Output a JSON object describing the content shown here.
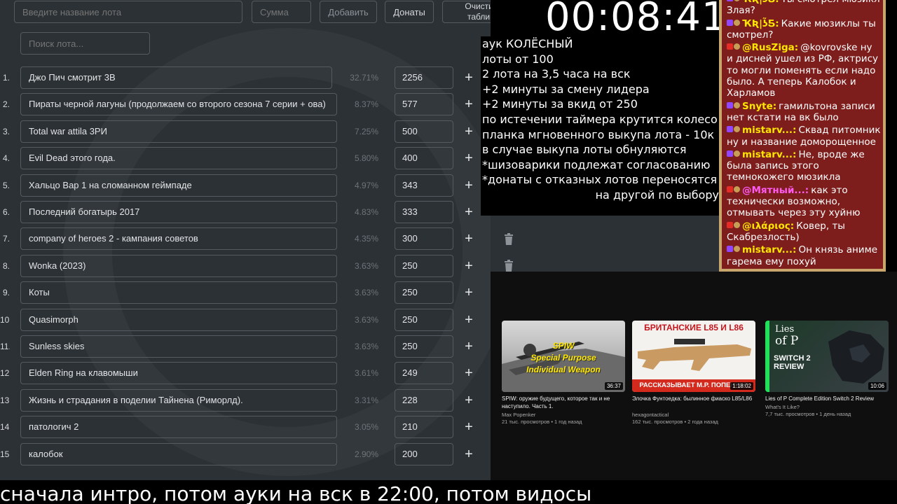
{
  "auction": {
    "lot_name_placeholder": "Введите название лота",
    "amount_placeholder": "Сумма",
    "add_button": "Добавить",
    "donations_button": "Донаты",
    "clear_line1": "Очистить",
    "clear_line2": "таблицу",
    "search_placeholder": "Поиск лота...",
    "lots": [
      {
        "num": "1.",
        "name": "Джо Пич смотрит 3В",
        "percent": "32.71%",
        "amount": "2256"
      },
      {
        "num": "2.",
        "name": "Пираты черной лагуны (продолжаем со второго сезона 7 серии + ова)",
        "percent": "8.37%",
        "amount": "577"
      },
      {
        "num": "3.",
        "name": "Total war attila 3РИ",
        "percent": "7.25%",
        "amount": "500"
      },
      {
        "num": "4.",
        "name": "Evil Dead этого года.",
        "percent": "5.80%",
        "amount": "400"
      },
      {
        "num": "5.",
        "name": "Хальцо Вар 1 на сломанном геймпаде",
        "percent": "4.97%",
        "amount": "343"
      },
      {
        "num": "6.",
        "name": "Последний богатырь 2017",
        "percent": "4.83%",
        "amount": "333"
      },
      {
        "num": "7.",
        "name": "company of heroes 2 - кампания советов",
        "percent": "4.35%",
        "amount": "300"
      },
      {
        "num": "8.",
        "name": "Wonka (2023)",
        "percent": "3.63%",
        "amount": "250"
      },
      {
        "num": "9.",
        "name": "Коты",
        "percent": "3.63%",
        "amount": "250"
      },
      {
        "num": "10.",
        "name": "Quasimorph",
        "percent": "3.63%",
        "amount": "250"
      },
      {
        "num": "11.",
        "name": "Sunless skies",
        "percent": "3.63%",
        "amount": "250"
      },
      {
        "num": "12.",
        "name": "Elden Ring на клавомыши",
        "percent": "3.61%",
        "amount": "249"
      },
      {
        "num": "13.",
        "name": "Жизнь и страдания в поделии Тайнена (Риморлд).",
        "percent": "3.31%",
        "amount": "228"
      },
      {
        "num": "14.",
        "name": "патологич 2",
        "percent": "3.05%",
        "amount": "210"
      },
      {
        "num": "15.",
        "name": "калобок",
        "percent": "2.90%",
        "amount": "200"
      }
    ],
    "plus_symbol": "+"
  },
  "timer": "00:08:41",
  "rules": [
    "аук КОЛЁСНЫЙ",
    "лоты от 100",
    "2 лота на 3,5 часа на вск",
    "+2 минуты за смену лидера",
    "+2 минуты за вкид от 250",
    "по истечении таймера крутится колесо",
    "планка мгновенного выкупа лота - 10к",
    "в случае выкупа лоты обнуляются",
    "*шизоварики подлежат согласованию",
    "*донаты с отказных лотов переносятся",
    "на другой по выбору"
  ],
  "chat": [
    {
      "platform": "twitch",
      "nick": "ҠƦ|ʖ̃Ƽ:",
      "nick_color": "#ffe600",
      "text": "Ты смотрел мюзикл Злая?"
    },
    {
      "platform": "twitch",
      "nick": "ҠƦ|ʖ̃Ƽ:",
      "nick_color": "#ffe600",
      "text": "Какие мюзиклы ты смотрел?"
    },
    {
      "platform": "youtube",
      "nick": "@RusZiga:",
      "nick_color": "#ffe600",
      "text": "@kovrovske ну и дисней ушел из РФ, актрису то могли поменять если надо было. А теперь Калобок и Харламов"
    },
    {
      "platform": "twitch",
      "nick": "Snyte:",
      "nick_color": "#ffe600",
      "text": "гамильтона записи нет кстати на вк было"
    },
    {
      "platform": "twitch",
      "nick": "mistarv...:",
      "nick_color": "#ffe600",
      "text": "Сквад питомник ну и название доморощенное"
    },
    {
      "platform": "twitch",
      "nick": "mistarv...:",
      "nick_color": "#ffe600",
      "text": "Не, вроде же была запись этого темнокожего мюзикла"
    },
    {
      "platform": "youtube",
      "nick": "@Мятный...:",
      "nick_color": "#ff5af2",
      "text": "как это технически возможно, отмывать через эту хуйню"
    },
    {
      "platform": "youtube",
      "nick": "@ιλάριος:",
      "nick_color": "#ffe600",
      "text": "Ковер, ты Скабрезлость)"
    },
    {
      "platform": "twitch",
      "nick": "mistarv...:",
      "nick_color": "#ffe600",
      "text": "Он князь аниме гарема ему похуй"
    }
  ],
  "videos": [
    {
      "thumb_line1": "SPIW",
      "thumb_line2": "Special Purpose",
      "thumb_line3": "Individual Weapon",
      "duration": "36:37",
      "title": "SPIW: оружие будущего, которое так и не наступило. Часть 1.",
      "channel": "Max Popenker",
      "meta": "21 тыс. просмотров • 1 год назад"
    },
    {
      "thumb_top": "БРИТАНСКИЕ L85 И L86",
      "thumb_bottom": "РАССКАЗЫВАЕТ М.Р. ПОПЕНКЕР",
      "duration": "1:18:02",
      "title": "Элочка Фунтоедка: былинное фиаско L85/L86",
      "channel": "hexagontactical",
      "meta": "162 тыс. просмотров • 2 года назад"
    },
    {
      "thumb_logo": "Lies",
      "thumb_logo2": "of P",
      "thumb_sub": "SWITCH 2",
      "thumb_sub2": "REVIEW",
      "duration": "10:06",
      "title": "Lies of P Complete Edition Switch 2 Review",
      "channel": "What's It Like?",
      "meta": "7,7 тыс. просмотров • 1 день назад"
    }
  ],
  "ticker": "сначала интро, потом ауки на вск в 22:00, потом видосы",
  "colors": {
    "panel_bg": "#2c3135",
    "chat_bg": "#7d1d1c",
    "chat_border": "#c9a66b",
    "nick_yellow": "#ffe600",
    "nick_pink": "#ff5af2"
  }
}
